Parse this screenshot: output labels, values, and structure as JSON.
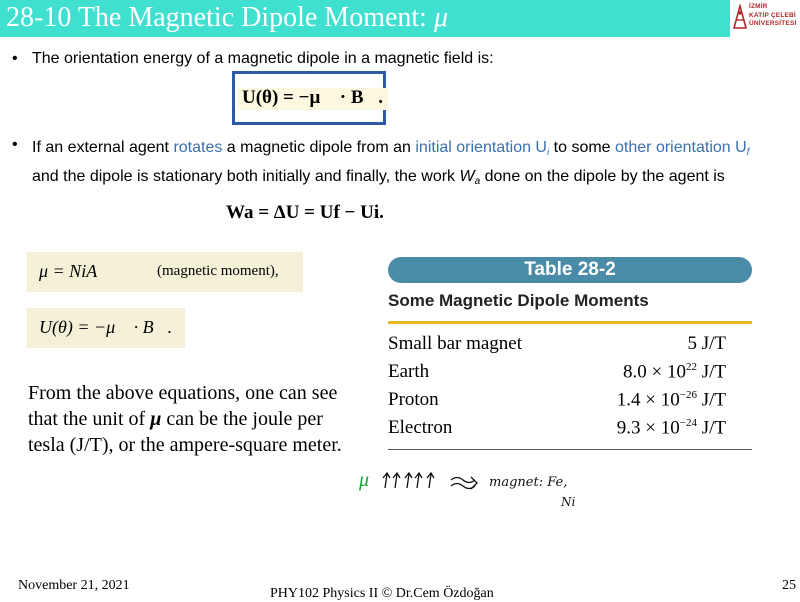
{
  "title": {
    "text": "28-10 The Magnetic Dipole Moment: ",
    "symbol": "μ"
  },
  "logo": {
    "line1": "İZMİR",
    "line2": "KATİP ÇELEBİ",
    "line3": "ÜNİVERSİTESİ",
    "color": "#b0282c"
  },
  "bullets": {
    "first": "The orientation energy of a magnetic dipole in a magnetic field is:",
    "second": {
      "p1": "If an external agent ",
      "p2": "rotates",
      "p3": " a magnetic dipole from an ",
      "p4": "initial orientation U",
      "p4sub": "i",
      "p5": " to some ",
      "p6": "other orientation U",
      "p6sub": "f",
      "p7": " and the dipole is stationary both initially and finally, the work ",
      "p8": "W",
      "p8sub": "a",
      "p9": " done on the dipole by the agent is"
    }
  },
  "equations": {
    "energy_boxed": "U(θ) = −μ⃗ · B⃗.",
    "work": "Wa = ΔU = Uf − Ui.",
    "moment": "μ = NiA",
    "moment_note": "(magnetic moment),",
    "energy": "U(θ) = −μ⃗ · B⃗."
  },
  "paragraph": {
    "p1": "From the above equations, one can see that the unit of ",
    "mu": "μ",
    "p2": " can be the joule per tesla (J/T), or the ampere-square meter."
  },
  "table": {
    "header": "Table 28-2",
    "subtitle": "Some Magnetic Dipole Moments",
    "rows": [
      {
        "name": "Small bar magnet",
        "value": "5 J/T"
      },
      {
        "name": "Earth",
        "value": "8.0 × 10",
        "exp": "22",
        "unit": " J/T"
      },
      {
        "name": "Proton",
        "value": "1.4 × 10",
        "exp": "−26",
        "unit": " J/T"
      },
      {
        "name": "Electron",
        "value": "9.3 × 10",
        "exp": "−24",
        "unit": " J/T"
      }
    ]
  },
  "annotation": {
    "mu": "μ",
    "text1": "magnet: Fe,",
    "text2": "Ni"
  },
  "footer": {
    "date": "November 21, 2021",
    "course": "PHY102 Physics II © Dr.Cem Özdoğan",
    "page": "25"
  },
  "colors": {
    "title_bar": "#40e0d0",
    "box_border": "#2e5aa8",
    "highlight_blue": "#3a6fb0",
    "table_header": "#4a8ba8",
    "table_rule": "#e8b820"
  }
}
